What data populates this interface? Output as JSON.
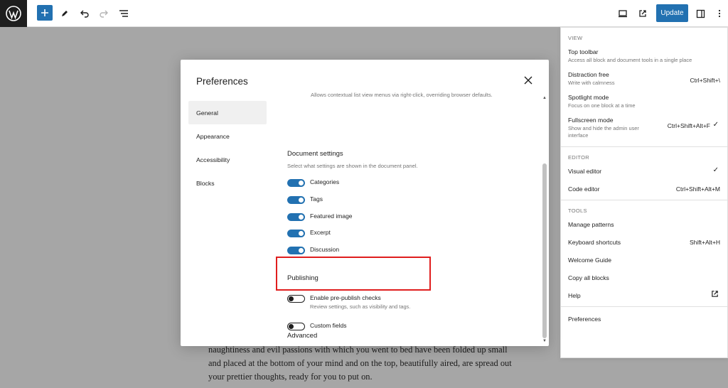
{
  "topbar": {
    "update_label": "Update"
  },
  "canvas": {
    "paragraph": "naughtiness and evil passions with which you went to bed have been folded up small and placed at the bottom of your mind and on the top, beautifully aired, are spread out your prettier thoughts, ready for you to put on."
  },
  "options_menu": {
    "view": {
      "label": "VIEW",
      "items": [
        {
          "label": "Top toolbar",
          "desc": "Access all block and document tools in a single place",
          "shortcut": ""
        },
        {
          "label": "Distraction free",
          "desc": "Write with calmness",
          "shortcut": "Ctrl+Shift+\\"
        },
        {
          "label": "Spotlight mode",
          "desc": "Focus on one block at a time",
          "shortcut": ""
        },
        {
          "label": "Fullscreen mode",
          "desc": "Show and hide the admin user interface",
          "shortcut": "Ctrl+Shift+Alt+F"
        }
      ]
    },
    "editor": {
      "label": "EDITOR",
      "items": [
        {
          "label": "Visual editor",
          "shortcut": ""
        },
        {
          "label": "Code editor",
          "shortcut": "Ctrl+Shift+Alt+M"
        }
      ]
    },
    "tools": {
      "label": "TOOLS",
      "items": [
        {
          "label": "Manage patterns",
          "shortcut": ""
        },
        {
          "label": "Keyboard shortcuts",
          "shortcut": "Shift+Alt+H"
        },
        {
          "label": "Welcome Guide",
          "shortcut": ""
        },
        {
          "label": "Copy all blocks",
          "shortcut": ""
        },
        {
          "label": "Help",
          "shortcut": ""
        }
      ]
    },
    "preferences_label": "Preferences"
  },
  "modal": {
    "title": "Preferences",
    "nav": [
      "General",
      "Appearance",
      "Accessibility",
      "Blocks"
    ],
    "cut_desc": "Allows contextual list view menus via right-click, overriding browser defaults.",
    "document_settings": {
      "title": "Document settings",
      "desc": "Select what settings are shown in the document panel.",
      "toggles": [
        "Categories",
        "Tags",
        "Featured image",
        "Excerpt",
        "Discussion"
      ]
    },
    "publishing": {
      "title": "Publishing",
      "toggle_label": "Enable pre-publish checks",
      "toggle_help": "Review settings, such as visibility and tags."
    },
    "advanced": {
      "title": "Advanced",
      "toggle_label": "Custom fields"
    }
  }
}
